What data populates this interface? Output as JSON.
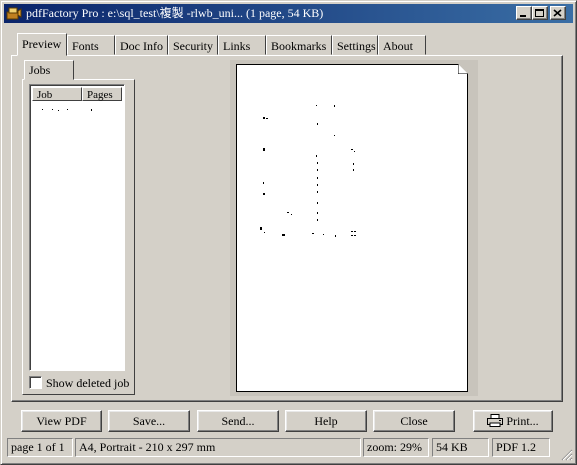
{
  "window": {
    "title": "pdfFactory Pro : e:\\sql_test\\複製 -rlwb_uni... (1 page, 54 KB)"
  },
  "tabs": [
    {
      "label": "Preview",
      "active": true
    },
    {
      "label": "Fonts"
    },
    {
      "label": "Doc Info"
    },
    {
      "label": "Security"
    },
    {
      "label": "Links"
    },
    {
      "label": "Bookmarks"
    },
    {
      "label": "Settings"
    },
    {
      "label": "About"
    }
  ],
  "jobs": {
    "tab_label": "Jobs",
    "columns": [
      "Job",
      "Pages"
    ],
    "show_deleted_label": "Show deleted job",
    "show_deleted_checked": false
  },
  "buttons": {
    "view_pdf": "View PDF",
    "save": "Save...",
    "send": "Send...",
    "help": "Help",
    "close": "Close",
    "print": "Print..."
  },
  "status": {
    "page": "page 1 of 1",
    "paper": "A4, Portrait - 210 x 297 mm",
    "zoom": "zoom: 29%",
    "size": "54 KB",
    "pdf_version": "PDF 1.2"
  }
}
